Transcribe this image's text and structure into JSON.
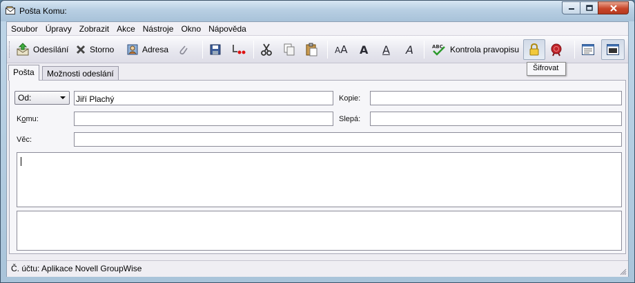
{
  "window": {
    "title": "Pošta Komu:",
    "icon": "mail-compose-icon",
    "controls": [
      "minimize-icon",
      "maximize-icon",
      "close-icon"
    ]
  },
  "menu": [
    "Soubor",
    "Úpravy",
    "Zobrazit",
    "Akce",
    "Nástroje",
    "Okno",
    "Nápověda"
  ],
  "toolbar": {
    "send_label": "Odesílání",
    "cancel_label": "Storno",
    "address_label": "Adresa",
    "spellcheck_label": "Kontrola pravopisu",
    "spellcheck_icon_text": "ABC",
    "icons": [
      "send-icon",
      "cancel-icon",
      "address-book-icon",
      "attach-icon",
      "save-icon",
      "delivery-options-icon",
      "cut-icon",
      "copy-icon",
      "paste-icon",
      "font-size-icon",
      "bold-icon",
      "underline-icon",
      "italic-icon",
      "spellcheck-icon",
      "encrypt-lock-icon",
      "sign-seal-icon",
      "view-icon",
      "layout-icon"
    ],
    "font_glyph": "A",
    "tooltip": "Šifrovat"
  },
  "tabs": [
    "Pošta",
    "Možnosti odeslání"
  ],
  "form": {
    "from_select": "Od:",
    "from_value": "Jiří Plachý",
    "to_label_pre": "K",
    "to_label_ul": "o",
    "to_label_post": "mu:",
    "to_value": "",
    "subject_label": "Věc:",
    "subject_value": "",
    "cc_label": "Kopie:",
    "cc_value": "",
    "bcc_label": "Slepá:",
    "bcc_value": ""
  },
  "status": "Č. účtu: Aplikace Novell GroupWise",
  "colors": {
    "title_gradient": "#b8cfe3",
    "close_button": "#c8462a",
    "workspace": "#eeedf2"
  }
}
